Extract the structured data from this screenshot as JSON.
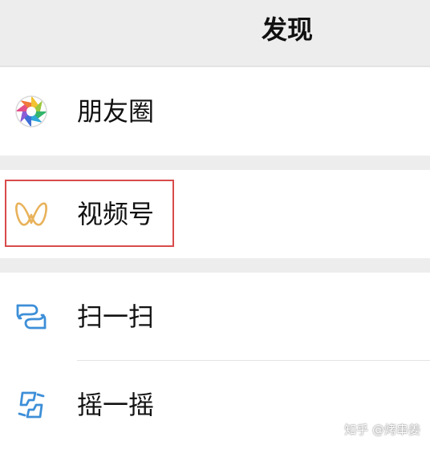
{
  "header": {
    "title": "发现"
  },
  "menu": [
    {
      "label": "朋友圈",
      "icon": "moments-aperture-icon"
    },
    {
      "label": "视频号",
      "icon": "channels-butterfly-icon"
    },
    {
      "label": "扫一扫",
      "icon": "scan-icon"
    },
    {
      "label": "摇一摇",
      "icon": "shake-icon"
    }
  ],
  "watermark": "知乎 @烤串姜",
  "colors": {
    "background": "#ededed",
    "row_background": "#ffffff",
    "highlight_border": "#d94b4b",
    "channels_icon": "#e8b25a",
    "scan_icon": "#3d8fd8",
    "shake_icon": "#3d8fd8"
  }
}
